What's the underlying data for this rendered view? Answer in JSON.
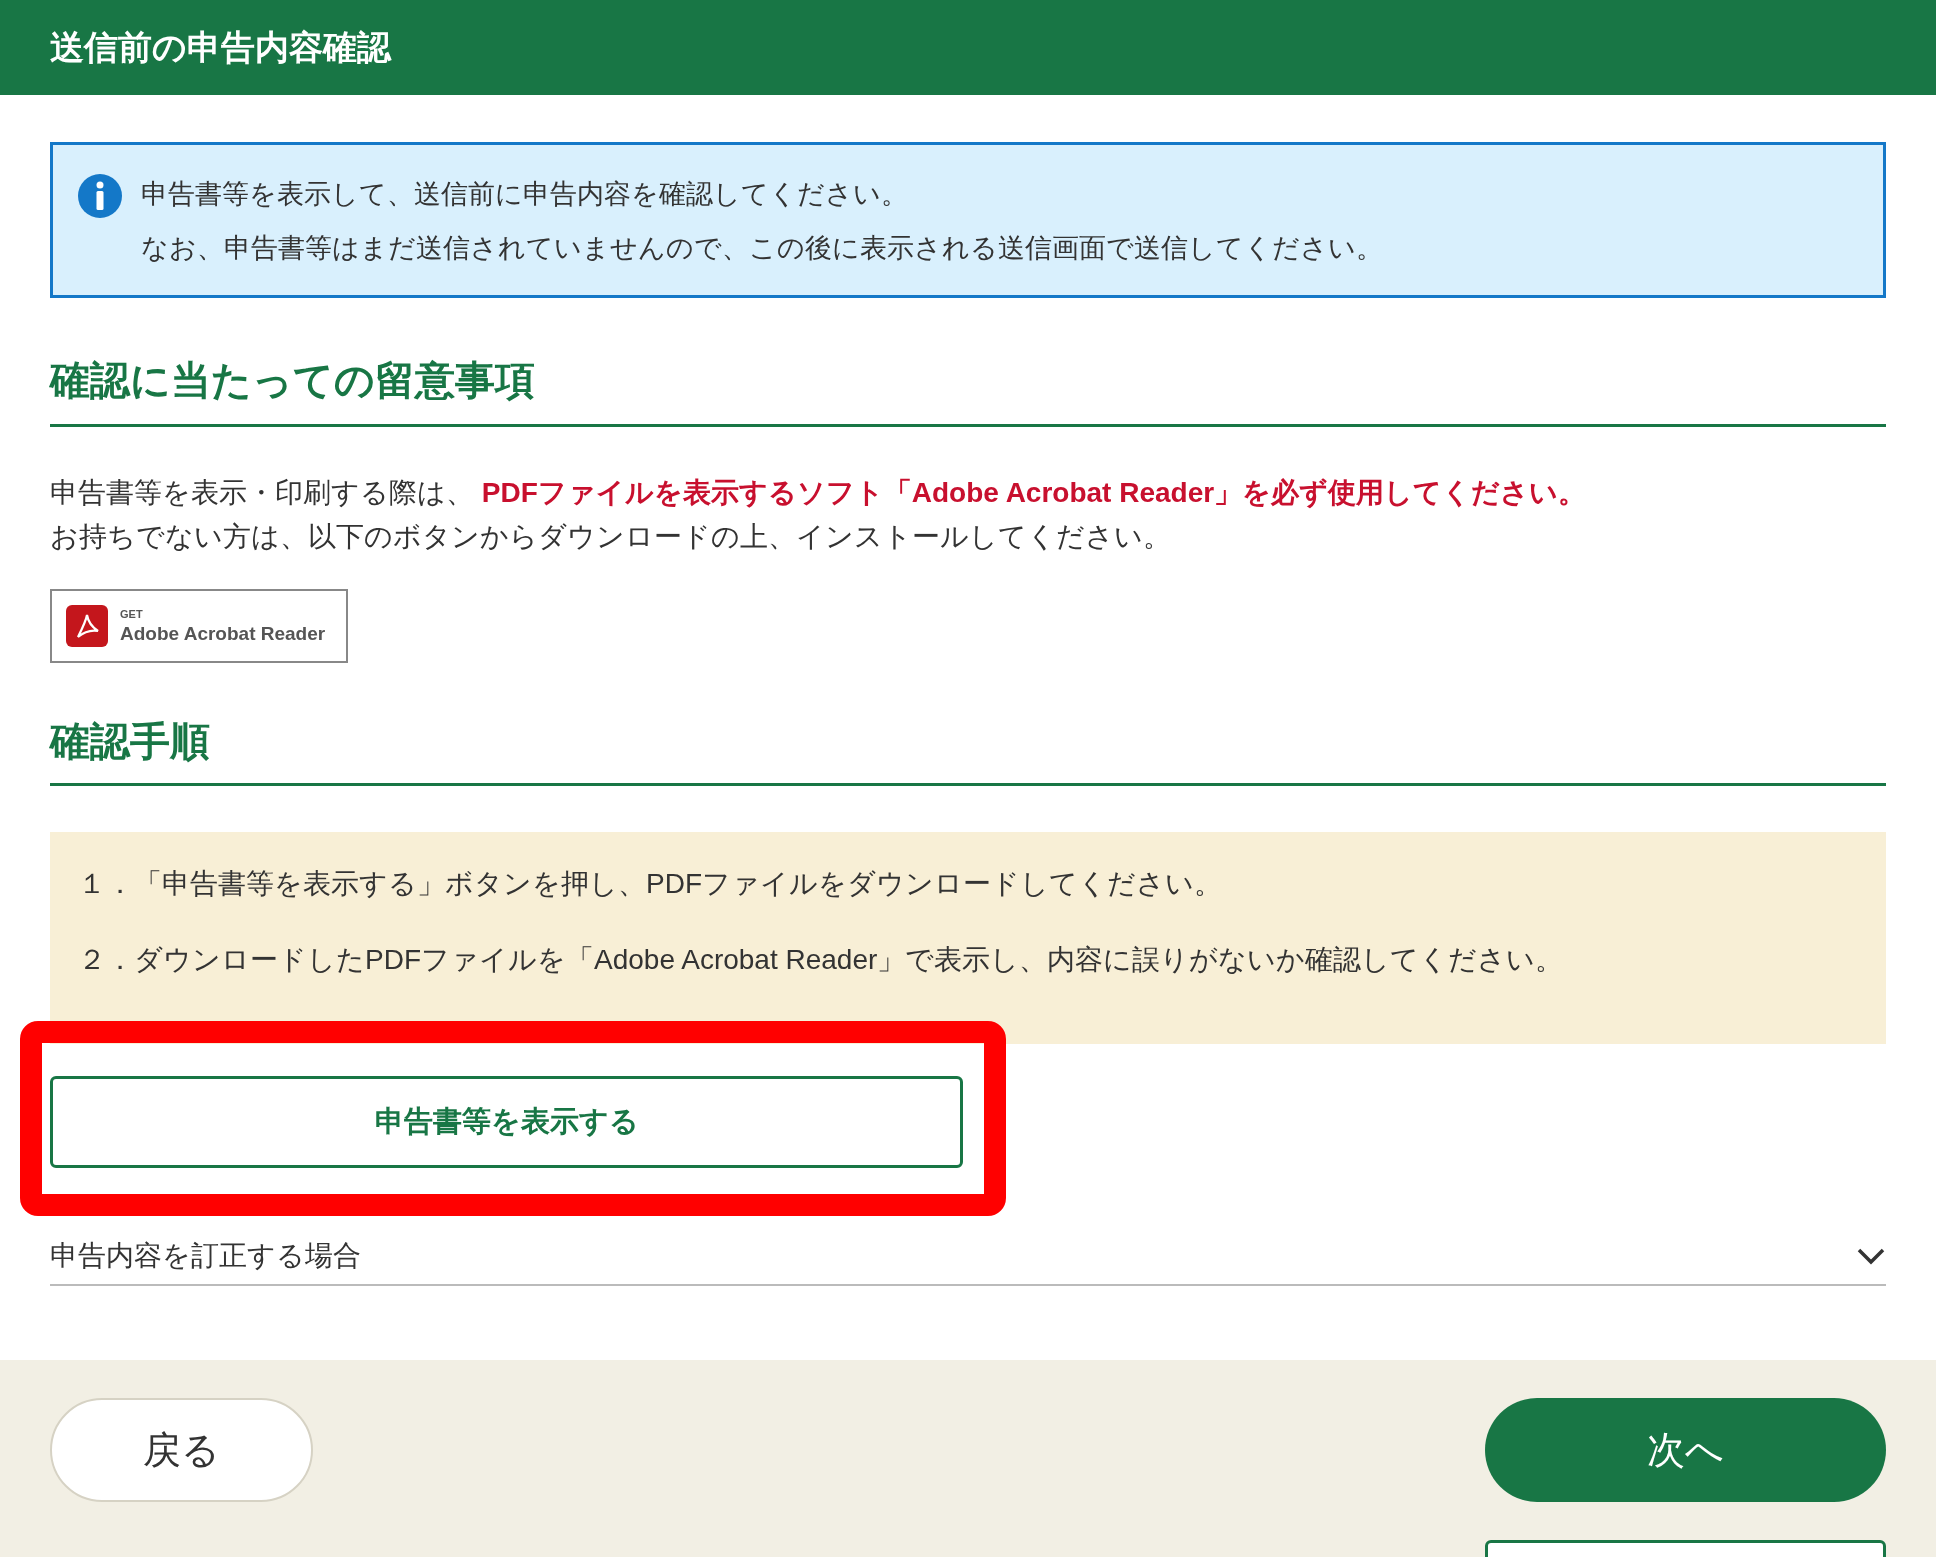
{
  "header": {
    "title": "送信前の申告内容確認"
  },
  "info": {
    "lines": [
      "申告書等を表示して、送信前に申告内容を確認してください。",
      "なお、申告書等はまだ送信されていませんので、この後に表示される送信画面で送信してください。"
    ]
  },
  "notes": {
    "heading": "確認に当たっての留意事項",
    "paragraph": "申告書等を表示・印刷する際は、 **PDFファイルを表示するソフト「Adobe Acrobat Reader」を必ず使用してください。**",
    "paragraph_2": "お持ちでない方は、以下のボタンからダウンロードの上、インストールしてください。",
    "download_badge": {
      "small": "GET",
      "large": "Adobe Acrobat Reader"
    }
  },
  "steps": {
    "heading": "確認手順",
    "items": [
      "１．「申告書等を表示する」ボタンを押し、PDFファイルをダウンロードしてください。",
      "２．ダウンロードしたPDFファイルを「Adobe Acrobat Reader」で表示し、内容に誤りがないか確認してください。"
    ],
    "display_button": "申告書等を表示する",
    "highlighted": true
  },
  "accordion": {
    "label": "申告内容を訂正する場合",
    "expanded": false
  },
  "footer": {
    "back_button": "戻る",
    "next_button": "次へ"
  }
}
